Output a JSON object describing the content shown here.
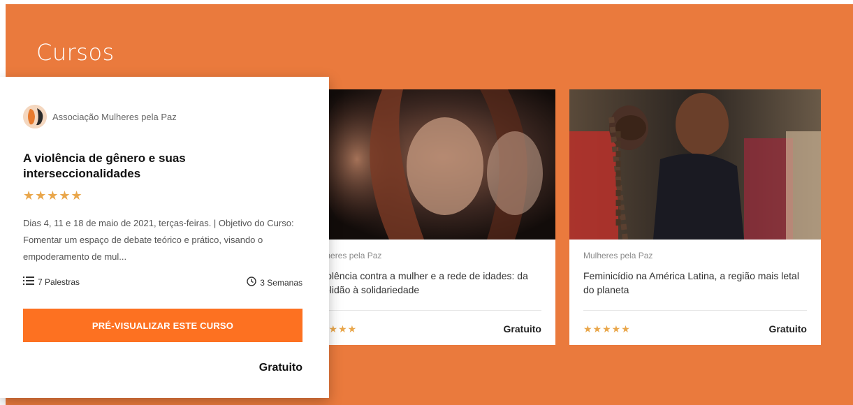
{
  "section": {
    "title": "Cursos"
  },
  "popup": {
    "author": "Associação Mulheres pela Paz",
    "title": "A violência de gênero e suas interseccionalidades",
    "rating": 5,
    "stars": "★★★★★",
    "description": "Dias 4, 11 e 18 de maio de 2021, terças-feiras. | Objetivo do Curso: Fomentar um espaço de debate teórico e prático, visando o empoderamento de mul...",
    "lectures": "7 Palestras",
    "duration": "3 Semanas",
    "button_label": "PRÉ-VISUALIZAR ESTE CURSO",
    "price": "Gratuito",
    "colors": {
      "accent": "#fd7121",
      "stars": "#e9a64a"
    },
    "icons": {
      "lectures": "list-icon",
      "duration": "clock-icon",
      "logo": "organization-logo"
    }
  },
  "cards": [
    {
      "author": "ulheres pela Paz",
      "title": "violência contra a mulher e a rede de idades: da solidão à solidariedade",
      "rating": 4,
      "stars": "★★★★",
      "price": "Gratuito"
    },
    {
      "author": "Mulheres pela Paz",
      "title": "Feminicídio na América Latina, a região mais letal do planeta",
      "rating": 5,
      "stars": "★★★★★",
      "price": "Gratuito"
    }
  ],
  "colors": {
    "background": "#ea7a3d",
    "card": "#ffffff"
  }
}
